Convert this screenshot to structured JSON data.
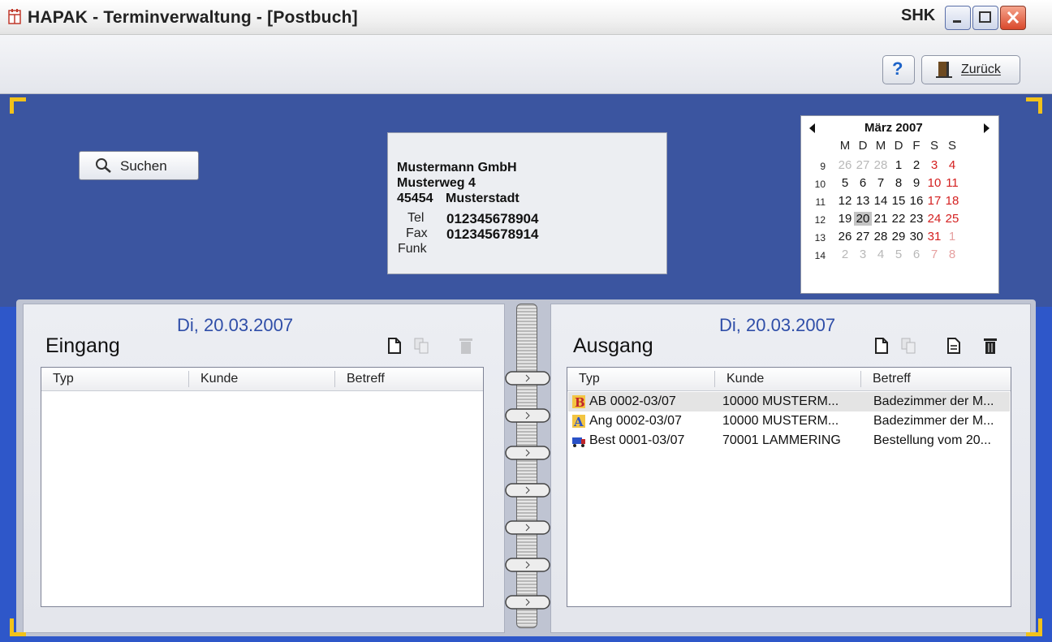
{
  "window": {
    "title": "HAPAK - Terminverwaltung - [Postbuch]",
    "user_tag": "SHK"
  },
  "toolbar": {
    "help_label": "?",
    "back_label": "Zurück"
  },
  "search": {
    "label": "Suchen"
  },
  "address": {
    "company": "Mustermann GmbH",
    "street": "Musterweg 4",
    "zip": "45454",
    "city": "Musterstadt",
    "tel_label": "Tel",
    "tel": "012345678904",
    "fax_label": "Fax",
    "fax": "012345678914",
    "funk_label": "Funk"
  },
  "calendar": {
    "month": "März 2007",
    "weekdays": [
      "M",
      "D",
      "M",
      "D",
      "F",
      "S",
      "S"
    ],
    "weeks": [
      "9",
      "10",
      "11",
      "12",
      "13",
      "14"
    ],
    "days": [
      [
        "26",
        "27",
        "28",
        "1",
        "2",
        "3",
        "4"
      ],
      [
        "5",
        "6",
        "7",
        "8",
        "9",
        "10",
        "11"
      ],
      [
        "12",
        "13",
        "14",
        "15",
        "16",
        "17",
        "18"
      ],
      [
        "19",
        "20",
        "21",
        "22",
        "23",
        "24",
        "25"
      ],
      [
        "26",
        "27",
        "28",
        "29",
        "30",
        "31",
        "1"
      ],
      [
        "2",
        "3",
        "4",
        "5",
        "6",
        "7",
        "8"
      ]
    ],
    "selected_day": "20"
  },
  "eingang": {
    "date": "Di, 20.03.2007",
    "title": "Eingang",
    "columns": [
      "Typ",
      "Kunde",
      "Betreff"
    ],
    "rows": []
  },
  "ausgang": {
    "date": "Di, 20.03.2007",
    "title": "Ausgang",
    "columns": [
      "Typ",
      "Kunde",
      "Betreff"
    ],
    "rows": [
      {
        "icon": "letter-b-icon",
        "typ": "AB 0002-03/07",
        "kunde": "10000 MUSTERM...",
        "betreff": "Badezimmer der M..."
      },
      {
        "icon": "letter-a-icon",
        "typ": "Ang 0002-03/07",
        "kunde": "10000 MUSTERM...",
        "betreff": "Badezimmer der M..."
      },
      {
        "icon": "truck-icon",
        "typ": "Best 0001-03/07",
        "kunde": "70001 LAMMERING",
        "betreff": "Bestellung vom 20..."
      }
    ]
  },
  "colors": {
    "header_blue": "#3b55a0",
    "date_blue": "#2f4ea8",
    "weekend_red": "#d42020",
    "corner_gold": "#f2c21a"
  }
}
